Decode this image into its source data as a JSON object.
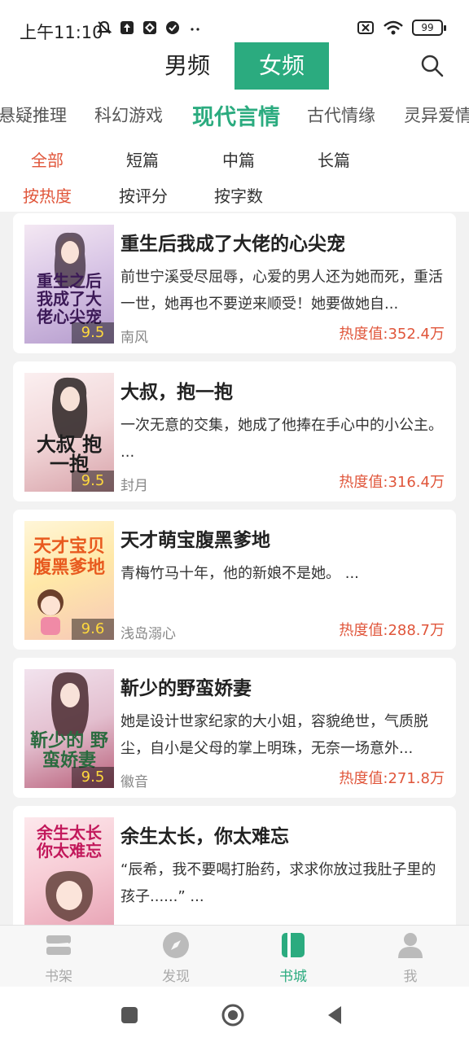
{
  "status": {
    "time": "上午11:10",
    "battery": "99"
  },
  "header": {
    "tabs": [
      "男频",
      "女频"
    ],
    "active_tab": "女频"
  },
  "categories": [
    "悬疑推理",
    "科幻游戏",
    "现代言情",
    "古代情缘",
    "灵异爱情"
  ],
  "active_category": "现代言情",
  "length_filters": [
    "全部",
    "短篇",
    "中篇",
    "长篇"
  ],
  "sort_filters": [
    "按热度",
    "按评分",
    "按字数"
  ],
  "books": [
    {
      "title": "重生后我成了大佬的心尖宠",
      "desc": "前世宁溪受尽屈辱，心爱的男人还为她而死，重活一世，她再也不要逆来顺受！她要做她自...",
      "author": "南风",
      "heat": "热度值:352.4万",
      "score": "9.5",
      "cover_text": "重生之后 我成了大佬心尖宠"
    },
    {
      "title": "大叔，抱一抱",
      "desc": "一次无意的交集，她成了他捧在手心中的小公主。 ...",
      "author": "封月",
      "heat": "热度值:316.4万",
      "score": "9.5",
      "cover_text": "大叔 抱一抱"
    },
    {
      "title": "天才萌宝腹黑爹地",
      "desc": "青梅竹马十年，他的新娘不是她。 ...",
      "author": "浅岛溺心",
      "heat": "热度值:288.7万",
      "score": "9.6",
      "cover_text": "天才宝贝 腹黑爹地"
    },
    {
      "title": "靳少的野蛮娇妻",
      "desc": "她是设计世家纪家的大小姐，容貌绝世，气质脱尘，自小是父母的掌上明珠，无奈一场意外...",
      "author": "徽音",
      "heat": "热度值:271.8万",
      "score": "9.5",
      "cover_text": "靳少的 野蛮娇妻"
    },
    {
      "title": "余生太长，你太难忘",
      "desc": "“辰希，我不要喝打胎药，求求你放过我肚子里的孩子......” ...",
      "author": "",
      "heat": "",
      "score": "",
      "cover_text": "余生太长 你太难忘"
    }
  ],
  "bottom_nav": [
    "书架",
    "发现",
    "书城",
    "我"
  ],
  "bottom_nav_active": "书城",
  "colors": {
    "accent": "#2bab7f",
    "heat": "#e0563b",
    "score": "#ffd93d"
  }
}
